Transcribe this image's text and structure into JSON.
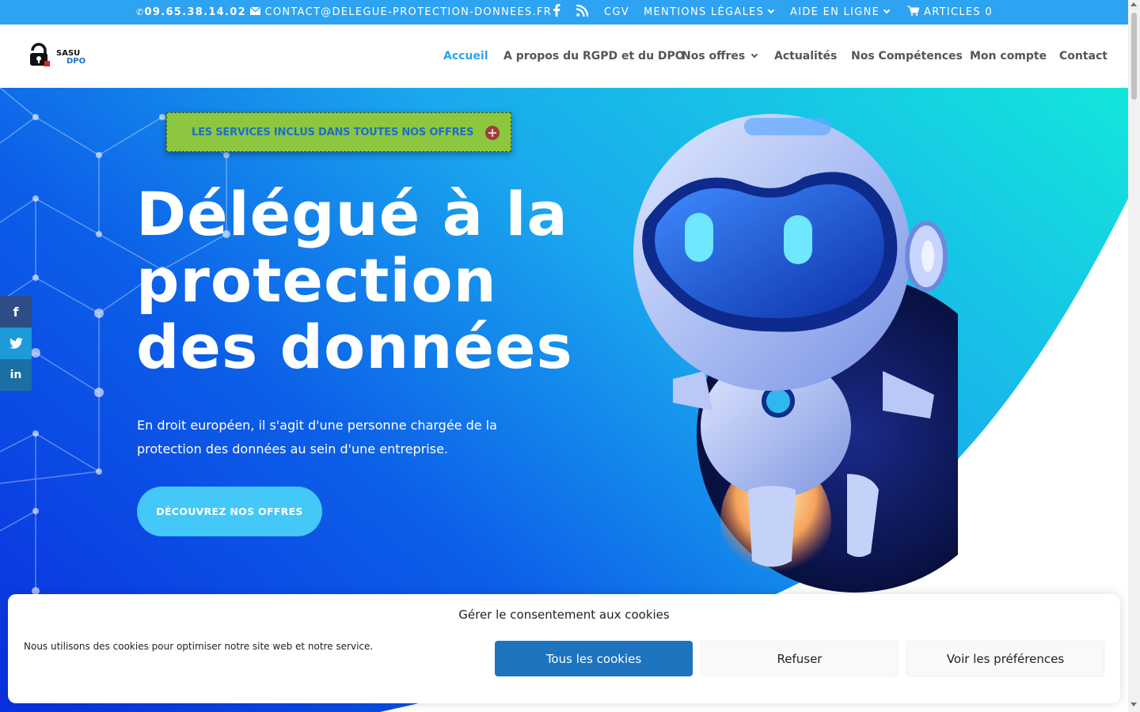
{
  "topbar": {
    "phone": "09.65.38.14.02",
    "email": "CONTACT@DELEGUE-PROTECTION-DONNEES.FR",
    "cgv": "CGV",
    "legal": "MENTIONS LÉGALES",
    "help": "AIDE EN LIGNE",
    "cart": "ARTICLES 0"
  },
  "logo": {
    "line1": "SASU",
    "line2": "DPO"
  },
  "nav": {
    "home": "Accueil",
    "about": "A propos du RGPD et du DPO",
    "offers": "Nos offres",
    "news": "Actualités",
    "skills": "Nos Compétences",
    "account": "Mon compte",
    "contact": "Contact"
  },
  "hero": {
    "accordion_label": "LES SERVICES INCLUS DANS TOUTES NOS OFFRES",
    "title_lines": [
      "Délégué à la",
      "protection",
      "des données"
    ],
    "text": "En droit européen, il s'agit d'une personne chargée de la protection des données au sein d'une entreprise.",
    "cta": "DÉCOUVREZ NOS OFFRES"
  },
  "social": {
    "facebook": "f",
    "twitter": "t",
    "linkedin": "in"
  },
  "cookie": {
    "title": "Gérer le consentement aux cookies",
    "text": "Nous utilisons des cookies pour optimiser notre site web et notre service.",
    "accept": "Tous les cookies",
    "deny": "Refuser",
    "prefs": "Voir les préférences"
  },
  "colors": {
    "topbar": "#2ea3f2",
    "accent": "#2ea3f2",
    "accordion": "#8dc63f",
    "cta": "#43c8f7",
    "cookie_accept": "#1e73be"
  },
  "icons": [
    "phone-icon",
    "mail-icon",
    "facebook-icon",
    "rss-icon",
    "cart-icon",
    "plus-icon",
    "twitter-icon",
    "linkedin-icon"
  ]
}
